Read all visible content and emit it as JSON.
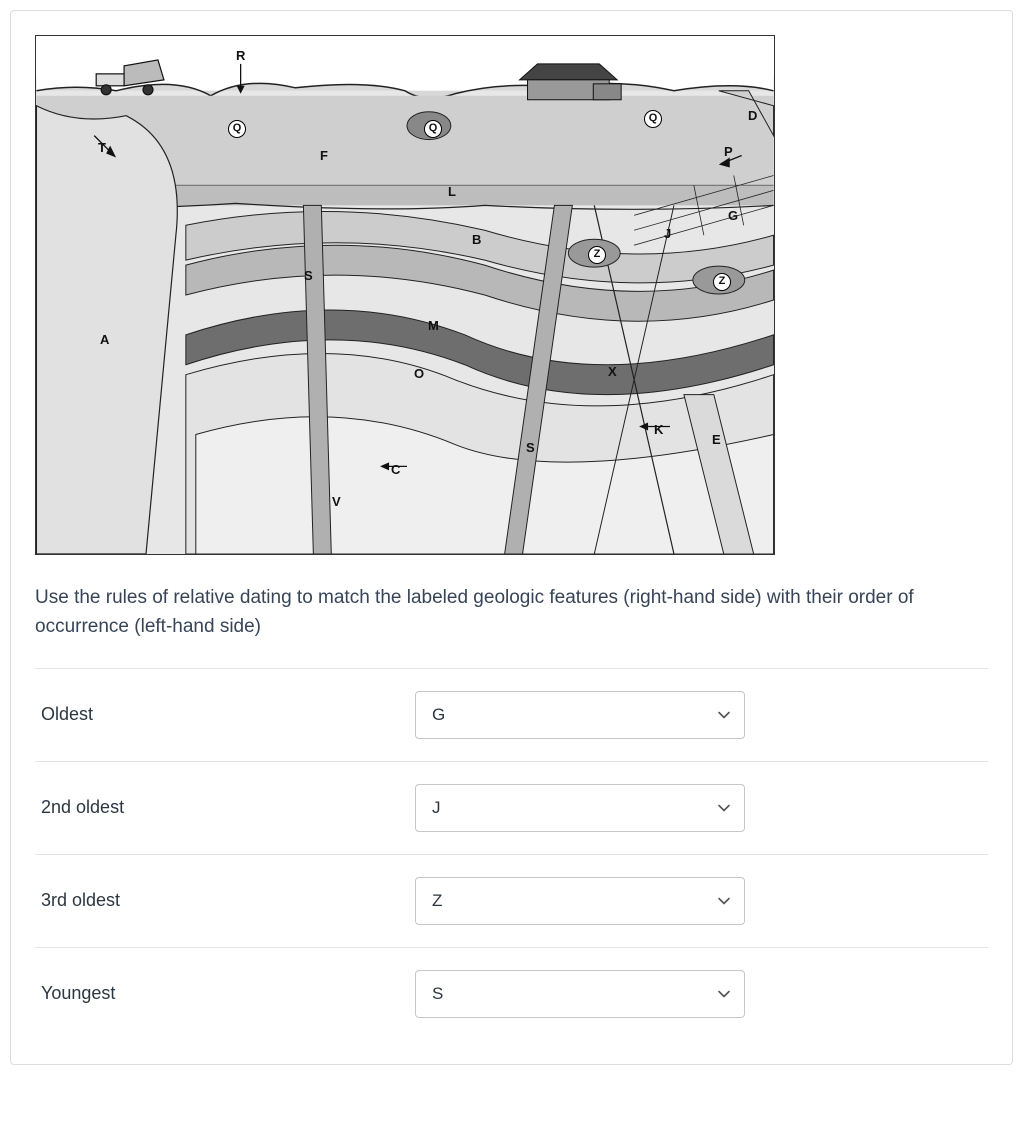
{
  "diagram": {
    "labels": {
      "R": "R",
      "Q": "Q",
      "D": "D",
      "T": "T",
      "F": "F",
      "P": "P",
      "L": "L",
      "G": "G",
      "B": "B",
      "J": "J",
      "S": "S",
      "Z": "Z",
      "A": "A",
      "M": "M",
      "O": "O",
      "X": "X",
      "K": "K",
      "E": "E",
      "C": "C",
      "V": "V"
    }
  },
  "prompt": "Use the rules of relative dating to match the labeled geologic features (right-hand side) with their order of occurrence (left-hand side)",
  "rows": [
    {
      "label": "Oldest",
      "value": "G"
    },
    {
      "label": "2nd oldest",
      "value": "J"
    },
    {
      "label": "3rd oldest",
      "value": "Z"
    },
    {
      "label": "Youngest",
      "value": "S"
    }
  ],
  "options": [
    "G",
    "J",
    "Z",
    "S"
  ]
}
